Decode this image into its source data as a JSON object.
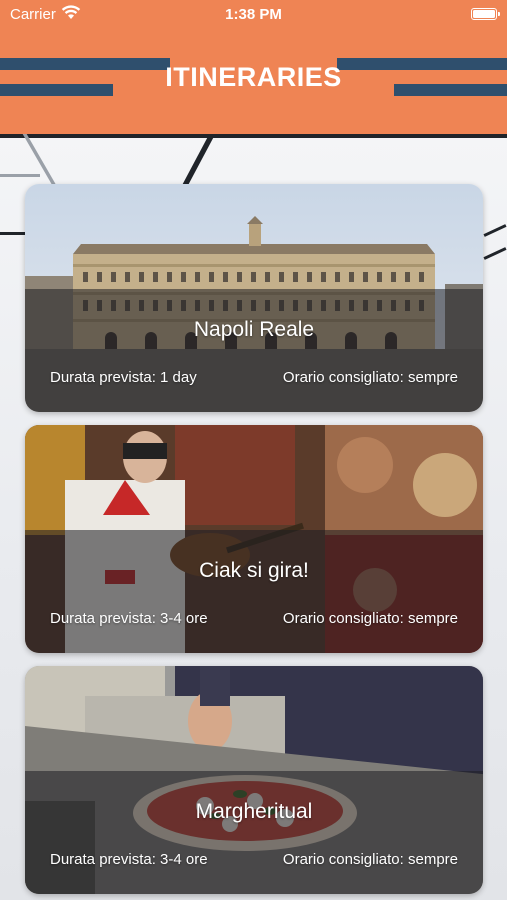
{
  "status_bar": {
    "carrier": "Carrier",
    "time": "1:38 PM"
  },
  "header": {
    "title": "ITINERARIES",
    "background_color": "#ef8454",
    "stripe_color": "#2f4f6d"
  },
  "itineraries": [
    {
      "name": "Napoli Reale",
      "duration": "Durata prevista: 1 day",
      "schedule": "Orario consigliato: sempre"
    },
    {
      "name": "Ciak si gira!",
      "duration": "Durata prevista: 3-4 ore",
      "schedule": "Orario consigliato: sempre"
    },
    {
      "name": "Margheritual",
      "duration": "Durata prevista: 3-4 ore",
      "schedule": "Orario consigliato: sempre"
    }
  ]
}
